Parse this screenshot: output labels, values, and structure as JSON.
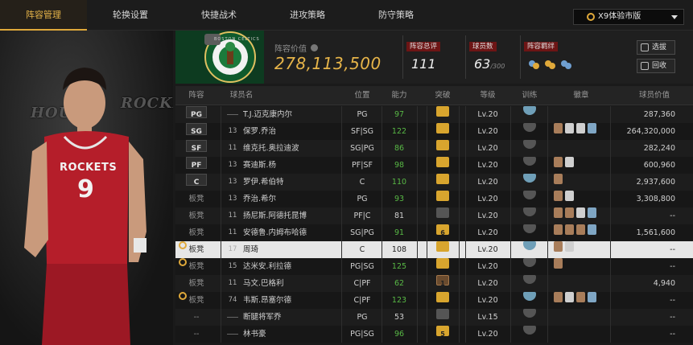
{
  "tabs": [
    "阵容管理",
    "轮换设置",
    "快捷战术",
    "进攻策略",
    "防守策略"
  ],
  "active_tab": 0,
  "version_select": "X9体验市版",
  "player_panel": {
    "bg_text_left": "HOUS",
    "bg_text_right": "ROCKE",
    "jersey_team": "ROCKETS",
    "jersey_number": "9"
  },
  "team_logo_text": "BOSTON CELTICS",
  "lineup_value": {
    "label": "阵容价值",
    "value": "278,113,500"
  },
  "stats": [
    {
      "label": "阵容总评",
      "value": "111",
      "sub": ""
    },
    {
      "label": "球员数",
      "value": "63",
      "sub": "/300"
    },
    {
      "label": "阵容羁绊",
      "value": "",
      "sub": ""
    }
  ],
  "buttons": {
    "select": "选拔",
    "recycle": "回收"
  },
  "headers": [
    "阵容",
    "球员名",
    "位置",
    "能力",
    "突破",
    "等级",
    "训练",
    "徽章",
    "球员价值"
  ],
  "rows": [
    {
      "pos": "PG",
      "num": "",
      "name": "T.J.迈克康内尔",
      "place": "PG",
      "ability": "97",
      "green": true,
      "bk": "gold",
      "bkn": "",
      "level": "Lv.20",
      "train": "blue",
      "badges": [],
      "value": "287,360",
      "alarm": false
    },
    {
      "pos": "SG",
      "num": "13",
      "name": "保罗.乔治",
      "place": "SF|SG",
      "ability": "122",
      "green": true,
      "bk": "gold",
      "bkn": "",
      "level": "Lv.20",
      "train": "gray",
      "badges": [
        "#a87d5a",
        "#cfcfcf",
        "#cfcfcf",
        "#7fa6c4"
      ],
      "value": "264,320,000",
      "alarm": false
    },
    {
      "pos": "SF",
      "num": "11",
      "name": "维克托.奥拉迪波",
      "place": "SG|PG",
      "ability": "86",
      "green": true,
      "bk": "gold",
      "bkn": "",
      "level": "Lv.20",
      "train": "gray",
      "badges": [],
      "value": "282,240",
      "alarm": false
    },
    {
      "pos": "PF",
      "num": "13",
      "name": "赛迪斯.杨",
      "place": "PF|SF",
      "ability": "98",
      "green": true,
      "bk": "gold",
      "bkn": "",
      "level": "Lv.20",
      "train": "gray",
      "badges": [
        "#a87d5a",
        "#cfcfcf"
      ],
      "value": "600,960",
      "alarm": false
    },
    {
      "pos": "C",
      "num": "13",
      "name": "罗伊.希伯特",
      "place": "C",
      "ability": "110",
      "green": true,
      "bk": "gold",
      "bkn": "",
      "level": "Lv.20",
      "train": "blue",
      "badges": [
        "#a87d5a"
      ],
      "value": "2,937,600",
      "alarm": false
    },
    {
      "pos": "板凳",
      "num": "13",
      "name": "乔治.希尔",
      "place": "PG",
      "ability": "93",
      "green": true,
      "bk": "gold",
      "bkn": "",
      "level": "Lv.20",
      "train": "gray",
      "badges": [
        "#a87d5a",
        "#cfcfcf"
      ],
      "value": "3,308,800",
      "alarm": false
    },
    {
      "pos": "板凳",
      "num": "11",
      "name": "扬尼斯.阿德托昆博",
      "place": "PF|C",
      "ability": "81",
      "green": false,
      "bk": "gray",
      "bkn": "",
      "level": "Lv.20",
      "train": "gray",
      "badges": [
        "#a87d5a",
        "#a87d5a",
        "#cfcfcf",
        "#7fa6c4"
      ],
      "value": "--",
      "alarm": false
    },
    {
      "pos": "板凳",
      "num": "11",
      "name": "安德鲁.内姆布哈德",
      "place": "SG|PG",
      "ability": "91",
      "green": true,
      "bk": "gold",
      "bkn": "6",
      "level": "Lv.20",
      "train": "gray",
      "badges": [
        "#a87d5a",
        "#a87d5a",
        "#a87d5a",
        "#7fa6c4"
      ],
      "value": "1,561,600",
      "alarm": false
    },
    {
      "pos": "板凳",
      "num": "17",
      "name": "周琦",
      "place": "C",
      "ability": "108",
      "green": false,
      "bk": "gold",
      "bkn": "",
      "level": "Lv.20",
      "train": "blue",
      "badges": [
        "#a87d5a",
        "#cfcfcf"
      ],
      "value": "--",
      "alarm": true,
      "selected": true
    },
    {
      "pos": "板凳",
      "num": "15",
      "name": "达米安.利拉德",
      "place": "PG|SG",
      "ability": "125",
      "green": true,
      "bk": "gold",
      "bkn": "",
      "level": "Lv.20",
      "train": "gray",
      "badges": [
        "#a87d5a"
      ],
      "value": "--",
      "alarm": true
    },
    {
      "pos": "板凳",
      "num": "11",
      "name": "马文.巴格利",
      "place": "C|PF",
      "ability": "62",
      "green": true,
      "bk": "brown",
      "bkn": "1",
      "level": "Lv.20",
      "train": "gray",
      "badges": [],
      "value": "4,940",
      "alarm": false
    },
    {
      "pos": "板凳",
      "num": "74",
      "name": "韦斯.昂塞尔德",
      "place": "C|PF",
      "ability": "123",
      "green": true,
      "bk": "gold",
      "bkn": "",
      "level": "Lv.20",
      "train": "blue",
      "badges": [
        "#a87d5a",
        "#cfcfcf",
        "#a87d5a",
        "#7fa6c4"
      ],
      "value": "--",
      "alarm": true
    },
    {
      "pos": "--",
      "num": "",
      "name": "断腿将军乔",
      "place": "PG",
      "ability": "53",
      "green": false,
      "bk": "gray",
      "bkn": "",
      "level": "Lv.15",
      "train": "gray",
      "badges": [],
      "value": "--",
      "alarm": false
    },
    {
      "pos": "--",
      "num": "",
      "name": "林书豪",
      "place": "PG|SG",
      "ability": "96",
      "green": true,
      "bk": "gold",
      "bkn": "5",
      "level": "Lv.20",
      "train": "gray",
      "badges": [],
      "value": "--",
      "alarm": false
    }
  ]
}
